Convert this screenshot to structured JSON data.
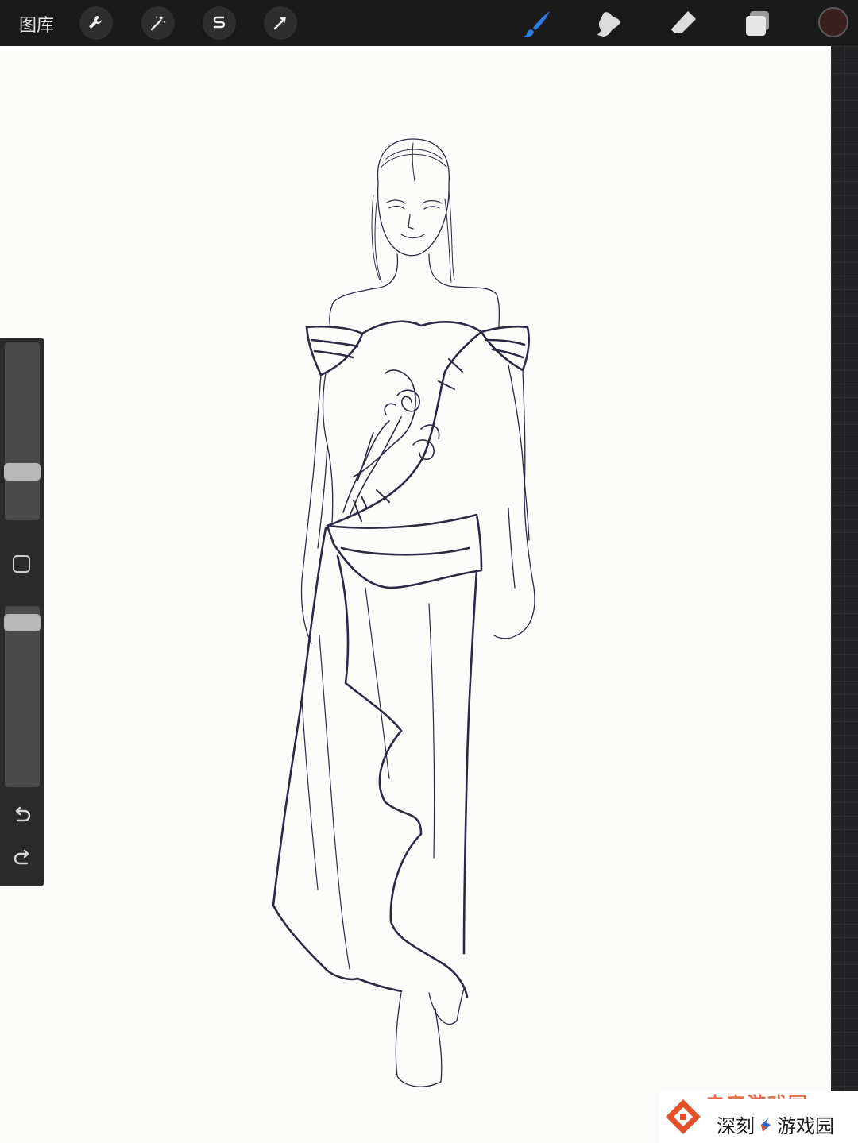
{
  "toolbar": {
    "gallery_label": "图库",
    "left_tools": [
      {
        "name": "actions",
        "icon": "wrench-icon"
      },
      {
        "name": "adjustments",
        "icon": "magic-wand-icon"
      },
      {
        "name": "selection",
        "icon": "selection-s-icon"
      },
      {
        "name": "transform",
        "icon": "arrow-cursor-icon"
      }
    ],
    "right_tools": [
      {
        "name": "brush",
        "icon": "brush-icon",
        "active": true
      },
      {
        "name": "smudge",
        "icon": "smudge-icon"
      },
      {
        "name": "eraser",
        "icon": "eraser-icon"
      },
      {
        "name": "layers",
        "icon": "layers-icon"
      }
    ],
    "current_color": "#3a1f1f",
    "active_color": "#2f7de1"
  },
  "sidebar": {
    "brush_size_level": 0.25,
    "opacity_level": 0.95,
    "modify_icon": "square-modify-icon",
    "undo_icon": "undo-icon",
    "redo_icon": "redo-icon"
  },
  "canvas": {
    "background": "#fcfcfa",
    "ink_color": "#2b2a45",
    "subject": "fashion-sketch"
  },
  "watermark": {
    "ghost_text": "未来游戏园",
    "text_left": "深刻",
    "text_right": "游戏园",
    "brand_color": "#e2512a"
  }
}
